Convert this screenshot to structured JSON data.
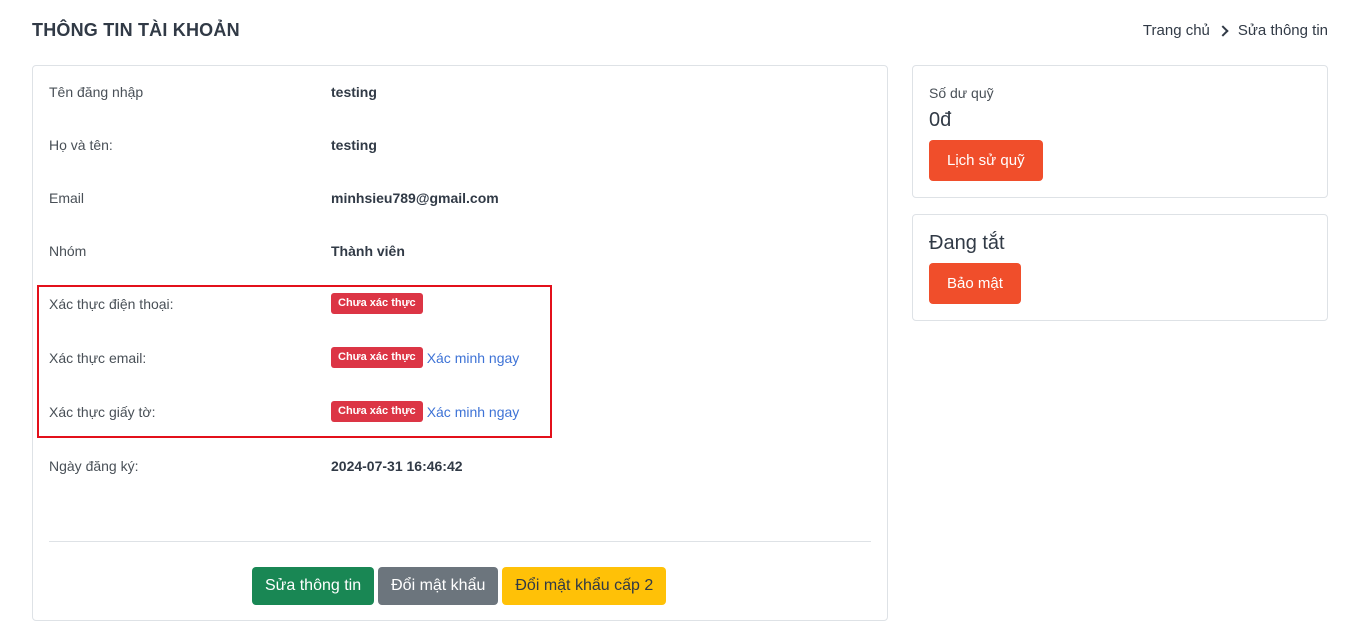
{
  "header": {
    "title": "THÔNG TIN TÀI KHOẢN",
    "breadcrumb": {
      "home": "Trang chủ",
      "current": "Sửa thông tin"
    }
  },
  "profile": {
    "username": {
      "label": "Tên đăng nhập",
      "value": "testing"
    },
    "fullname": {
      "label": "Họ và tên:",
      "value": "testing"
    },
    "email": {
      "label": "Email",
      "value": "minhsieu789@gmail.com"
    },
    "group": {
      "label": "Nhóm",
      "value": "Thành viên"
    },
    "verify_phone": {
      "label": "Xác thực điện thoại:",
      "badge": "Chưa xác thực"
    },
    "verify_email": {
      "label": "Xác thực email:",
      "badge": "Chưa xác thực",
      "link": "Xác minh ngay"
    },
    "verify_docs": {
      "label": "Xác thực giấy tờ:",
      "badge": "Chưa xác thực",
      "link": "Xác minh ngay"
    },
    "register_date": {
      "label": "Ngày đăng ký:",
      "value": "2024-07-31 16:46:42"
    }
  },
  "actions": {
    "edit_info": "Sửa thông tin",
    "change_password": "Đổi mật khẩu",
    "change_password_level2": "Đổi mật khẩu cấp 2"
  },
  "balance": {
    "label": "Số dư quỹ",
    "value": "0đ",
    "history_button": "Lịch sử quỹ"
  },
  "security": {
    "status": "Đang tắt",
    "button": "Bảo mật"
  },
  "colors": {
    "success": "#198754",
    "secondary": "#6c757d",
    "warning": "#ffc107",
    "danger": "#dc3545",
    "orange": "#f04e2b",
    "highlight": "#e3101b",
    "link": "#3e73d6"
  }
}
